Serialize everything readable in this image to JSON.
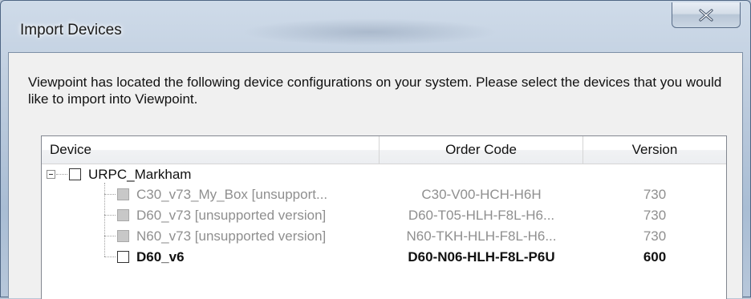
{
  "window": {
    "title": "Import Devices",
    "close_icon": "close-icon"
  },
  "intro": {
    "text": "Viewpoint has located the following device configurations on your system.  Please select the devices that you would like to import into Viewpoint."
  },
  "table": {
    "columns": [
      "Device",
      "Order Code",
      "Version"
    ],
    "root": {
      "name": "URPC_Markham",
      "checked": false
    },
    "rows": [
      {
        "name": "C30_v73_My_Box [unsupport...",
        "order_code": "C30-V00-HCH-H6H",
        "version": "730",
        "state": "disabled"
      },
      {
        "name": "D60_v73 [unsupported version]",
        "order_code": "D60-T05-HLH-F8L-H6...",
        "version": "730",
        "state": "disabled"
      },
      {
        "name": "N60_v73 [unsupported version]",
        "order_code": "N60-TKH-HLH-F8L-H6...",
        "version": "730",
        "state": "disabled"
      },
      {
        "name": "D60_v6",
        "order_code": "D60-N06-HLH-F8L-P6U",
        "version": "600",
        "state": "enabled"
      }
    ]
  },
  "colors": {
    "disabled_text": "#8f8f8f",
    "frame": "#b9c6d6"
  }
}
